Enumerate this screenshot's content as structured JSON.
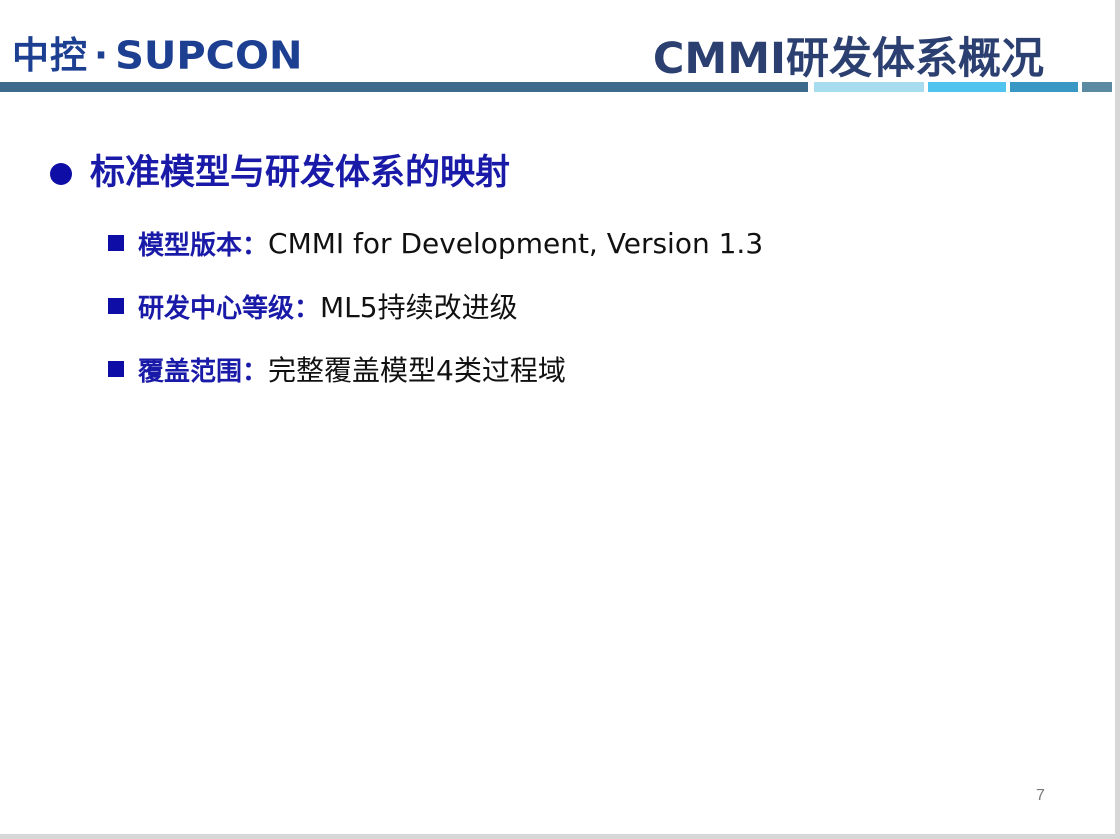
{
  "header": {
    "logo_cn": "中控",
    "logo_dot": "·",
    "logo_en": "SUPCON",
    "title": "CMMI研发体系概况"
  },
  "content": {
    "main_bullet": "标准模型与研发体系的映射",
    "items": [
      {
        "label": "模型版本：",
        "value": " CMMI for Development, Version 1.3"
      },
      {
        "label": "研发中心等级：",
        "value": "ML5持续改进级"
      },
      {
        "label": "覆盖范围：",
        "value": "完整覆盖模型4类过程域"
      }
    ]
  },
  "footer": {
    "page_number": "7"
  },
  "colors": {
    "brand_blue": "#1d3f92",
    "title_color": "#2b3f70",
    "bullet_blue": "#1a1aa8",
    "bar_dark": "#3e6b8c",
    "bar_light": "#a8dcef",
    "bar_cyan": "#51c3ef"
  }
}
